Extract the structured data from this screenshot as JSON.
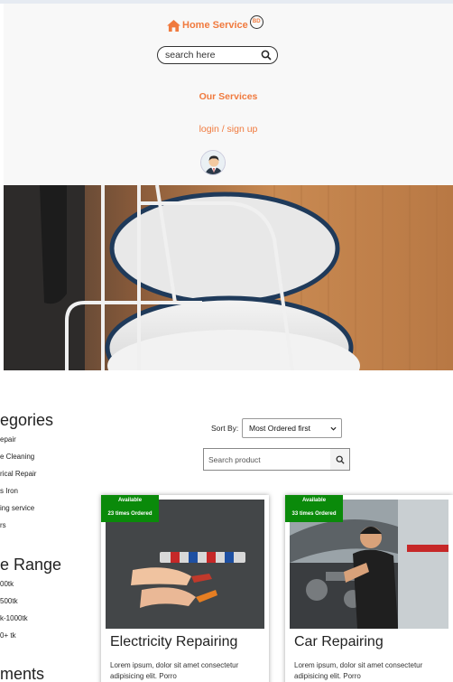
{
  "header": {
    "brand": "Home Service",
    "brand_badge": "BD",
    "search_placeholder": "search here",
    "nav_services": "Our Services",
    "nav_login": "login / sign up"
  },
  "sidebar": {
    "categories_heading": "egories",
    "categories": [
      "epair",
      "e Cleaning",
      "rical Repair",
      "s Iron",
      "ing service",
      "rs"
    ],
    "price_heading": "e Range",
    "prices": [
      "00tk",
      "500tk",
      "k-1000tk",
      "0+ tk"
    ],
    "third_heading": "ments"
  },
  "sort": {
    "label": "Sort By:",
    "selected": "Most Ordered first"
  },
  "product_search": {
    "placeholder": "Search product"
  },
  "cards": [
    {
      "badge_status": "Available",
      "badge_orders": "23 times Ordered",
      "title": "Electricity Repairing",
      "desc": "Lorem ipsum, dolor sit amet consectetur adipisicing elit. Porro"
    },
    {
      "badge_status": "Available",
      "badge_orders": "33 times Ordered",
      "title": "Car Repairing",
      "desc": "Lorem ipsum, dolor sit amet consectetur adipisicing elit. Porro"
    }
  ],
  "colors": {
    "accent": "#f07a3e",
    "badge_green": "#0a8a0a",
    "header_bg": "#f8f8f8"
  },
  "icons": [
    "home-icon",
    "search-icon",
    "user-avatar",
    "chevron-down-icon"
  ]
}
